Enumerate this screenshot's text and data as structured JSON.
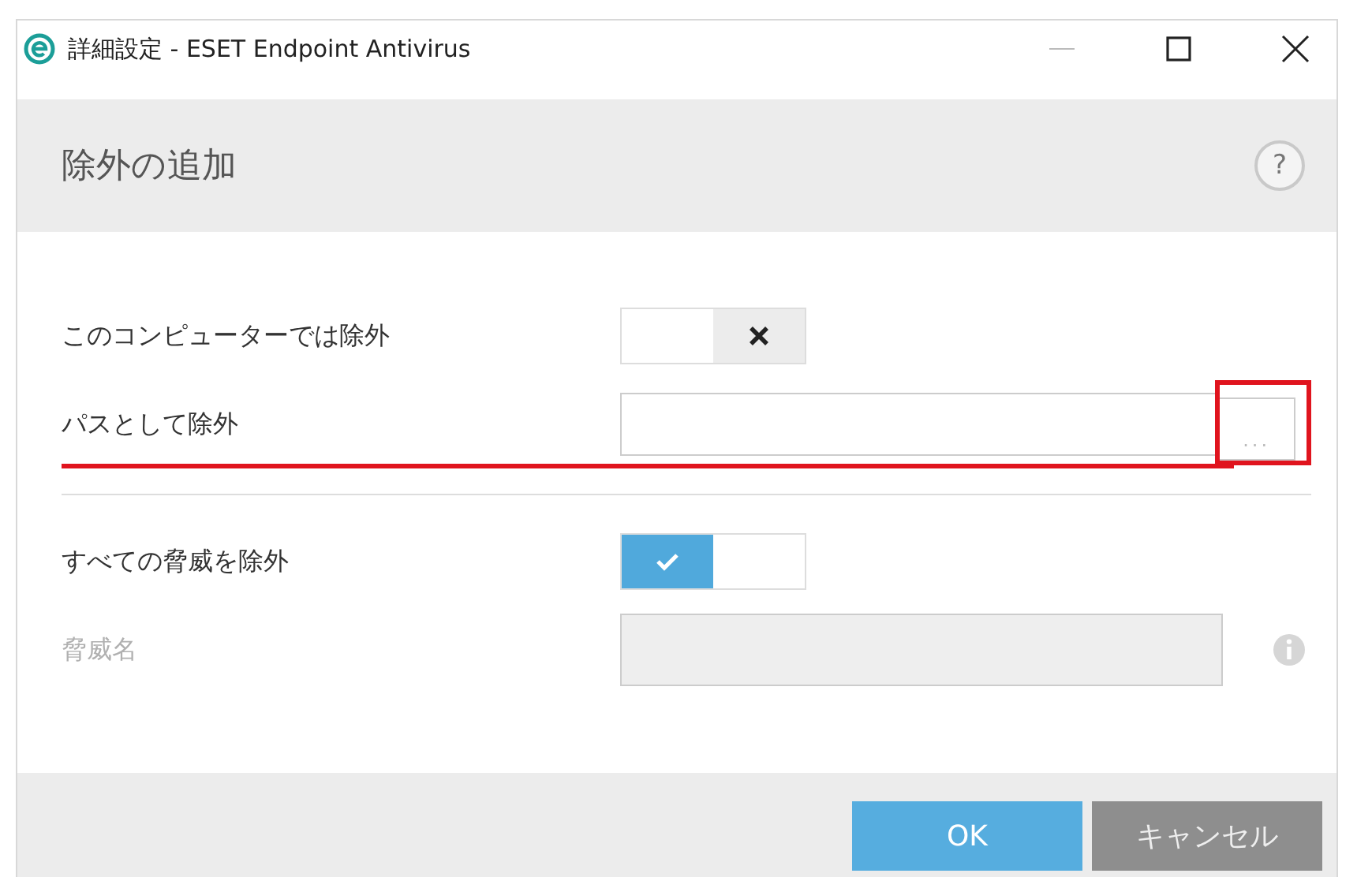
{
  "window": {
    "title": "詳細設定 - ESET Endpoint Antivirus"
  },
  "header": {
    "title": "除外の追加",
    "help": "?"
  },
  "rows": [
    {
      "kind": "toggle",
      "label": "このコンピューターでは除外",
      "on": false,
      "disabled": false
    },
    {
      "kind": "path",
      "label": "パスとして除外",
      "browse": "...",
      "disabled": false,
      "underlined": true,
      "boxed": true
    },
    {
      "kind": "divider"
    },
    {
      "kind": "toggle",
      "label": "すべての脅威を除外",
      "on": true,
      "disabled": false
    },
    {
      "kind": "text",
      "label": "脅威名",
      "disabled": true
    }
  ],
  "buttons": [
    {
      "label": "OK",
      "kind": "primary"
    },
    {
      "label": "キャンセル",
      "kind": "secondary"
    }
  ]
}
